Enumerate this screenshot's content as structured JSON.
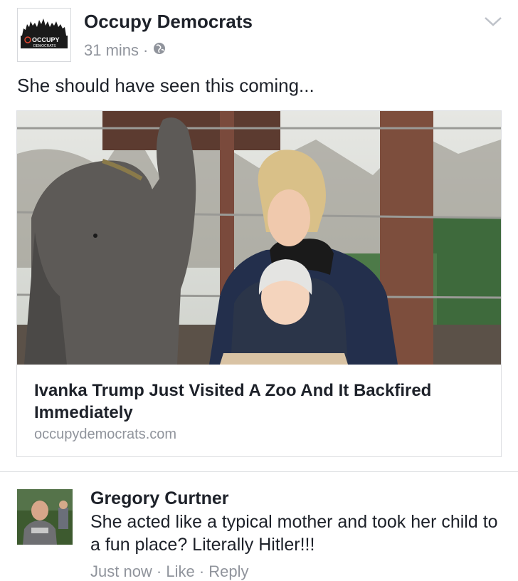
{
  "post": {
    "author": "Occupy Democrats",
    "avatar_text": "OCCUPY",
    "avatar_subtext": "DEMOCRATS",
    "timestamp": "31 mins",
    "separator": "·",
    "audience_icon": "globe-icon",
    "menu_icon": "chevron-down-icon",
    "text": "She should have seen this coming..."
  },
  "link": {
    "title": "Ivanka Trump Just Visited A Zoo And It Backfired Immediately",
    "domain": "occupydemocrats.com"
  },
  "comment": {
    "author": "Gregory Curtner",
    "text": "She acted like a typical mother and took her child to a fun place? Literally Hitler!!!",
    "actions": "Just now · Like · Reply"
  },
  "colors": {
    "text_primary": "#1d2129",
    "text_secondary": "#90949c",
    "border": "#dddfe2"
  }
}
